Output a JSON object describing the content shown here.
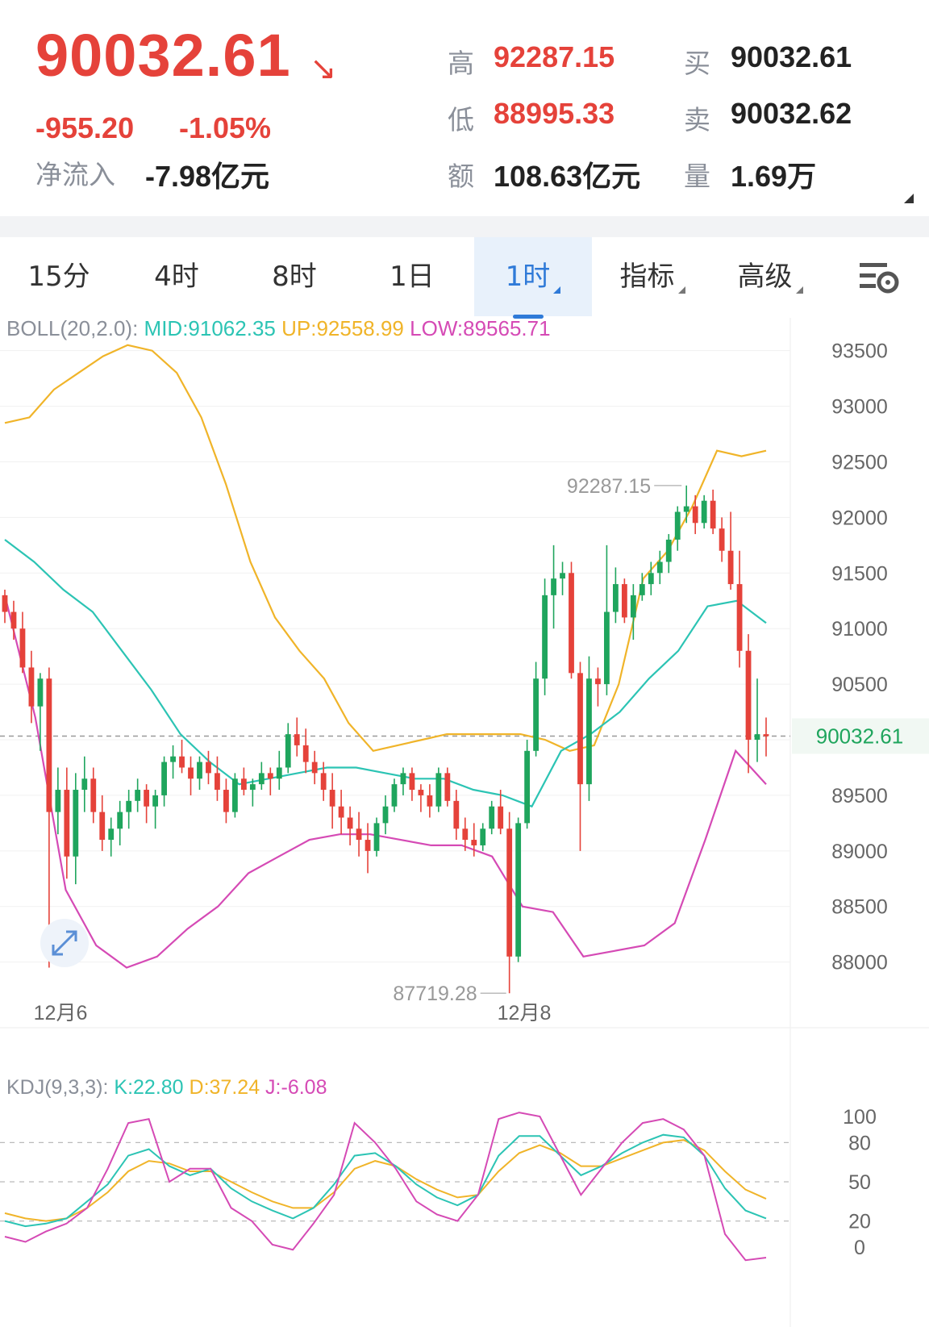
{
  "quote": {
    "price": "90032.61",
    "change": "-955.20",
    "change_pct": "-1.05%",
    "net_inflow_label": "净流入",
    "net_inflow_value": "-7.98亿元",
    "high_label": "高",
    "high_value": "92287.15",
    "low_label": "低",
    "low_value": "88995.33",
    "amount_label": "额",
    "amount_value": "108.63亿元",
    "buy_label": "买",
    "buy_value": "90032.61",
    "sell_label": "卖",
    "sell_value": "90032.62",
    "volume_label": "量",
    "volume_value": "1.69万"
  },
  "tabs": [
    {
      "label": "15分",
      "dropdown": false
    },
    {
      "label": "4时",
      "dropdown": false
    },
    {
      "label": "8时",
      "dropdown": false
    },
    {
      "label": "1日",
      "dropdown": false
    },
    {
      "label": "1时",
      "dropdown": true,
      "active": true
    },
    {
      "label": "指标",
      "dropdown": true
    },
    {
      "label": "高级",
      "dropdown": true
    }
  ],
  "boll": {
    "label": "BOLL(20,2.0):",
    "mid": "MID:91062.35",
    "up": "UP:92558.99",
    "low": "LOW:89565.71"
  },
  "kdj": {
    "label": "KDJ(9,3,3):",
    "k": "K:22.80",
    "d": "D:37.24",
    "j": "J:-6.08"
  },
  "colors": {
    "up": "#1fa55d",
    "down": "#e5423a",
    "mid": "#2cc4b4",
    "upper": "#f0b429",
    "lower": "#d54ab5",
    "accent": "#2f7ad8"
  },
  "chart_data": [
    {
      "type": "candlestick",
      "y_ticks": [
        "93500",
        "93000",
        "92500",
        "92000",
        "91500",
        "91000",
        "90500",
        "90000",
        "89500",
        "89000",
        "88500",
        "88000"
      ],
      "ylim": [
        87700,
        93650
      ],
      "x_labels": [
        "12月6",
        "12月8"
      ],
      "last_price": "90032.61",
      "annotations": {
        "high": "92287.15",
        "low": "87719.28"
      },
      "candles": [
        [
          91300,
          91350,
          91050,
          91150
        ],
        [
          91150,
          91250,
          90900,
          91000
        ],
        [
          91000,
          91150,
          90600,
          90650
        ],
        [
          90650,
          90800,
          90150,
          90300
        ],
        [
          90300,
          90600,
          89900,
          90550
        ],
        [
          90550,
          90650,
          87950,
          89350
        ],
        [
          89350,
          89750,
          89150,
          89550
        ],
        [
          89550,
          89750,
          88750,
          88950
        ],
        [
          88950,
          89700,
          88700,
          89550
        ],
        [
          89550,
          89850,
          89350,
          89650
        ],
        [
          89650,
          89750,
          89250,
          89350
        ],
        [
          89350,
          89500,
          89000,
          89100
        ],
        [
          89100,
          89300,
          88950,
          89200
        ],
        [
          89200,
          89450,
          89050,
          89350
        ],
        [
          89350,
          89550,
          89200,
          89450
        ],
        [
          89450,
          89650,
          89350,
          89550
        ],
        [
          89550,
          89600,
          89250,
          89400
        ],
        [
          89400,
          89550,
          89200,
          89500
        ],
        [
          89500,
          89850,
          89400,
          89800
        ],
        [
          89800,
          89950,
          89650,
          89850
        ],
        [
          89850,
          90000,
          89700,
          89750
        ],
        [
          89750,
          89850,
          89500,
          89650
        ],
        [
          89650,
          89850,
          89550,
          89800
        ],
        [
          89800,
          89900,
          89600,
          89700
        ],
        [
          89700,
          89850,
          89450,
          89550
        ],
        [
          89550,
          89650,
          89250,
          89350
        ],
        [
          89350,
          89700,
          89300,
          89650
        ],
        [
          89650,
          89750,
          89500,
          89550
        ],
        [
          89550,
          89650,
          89400,
          89600
        ],
        [
          89600,
          89800,
          89550,
          89700
        ],
        [
          89700,
          89750,
          89500,
          89650
        ],
        [
          89650,
          89900,
          89550,
          89750
        ],
        [
          89750,
          90150,
          89700,
          90050
        ],
        [
          90050,
          90200,
          89850,
          89950
        ],
        [
          89950,
          90100,
          89700,
          89800
        ],
        [
          89800,
          89900,
          89600,
          89700
        ],
        [
          89700,
          89800,
          89450,
          89550
        ],
        [
          89550,
          89700,
          89200,
          89400
        ],
        [
          89400,
          89550,
          89150,
          89300
        ],
        [
          89300,
          89400,
          89050,
          89200
        ],
        [
          89200,
          89350,
          88950,
          89100
        ],
        [
          89100,
          89250,
          88800,
          89000
        ],
        [
          89000,
          89300,
          88950,
          89250
        ],
        [
          89250,
          89500,
          89150,
          89400
        ],
        [
          89400,
          89650,
          89350,
          89600
        ],
        [
          89600,
          89750,
          89500,
          89700
        ],
        [
          89700,
          89750,
          89450,
          89550
        ],
        [
          89550,
          89600,
          89350,
          89500
        ],
        [
          89500,
          89600,
          89300,
          89400
        ],
        [
          89400,
          89750,
          89350,
          89700
        ],
        [
          89700,
          89750,
          89400,
          89450
        ],
        [
          89450,
          89550,
          89100,
          89200
        ],
        [
          89200,
          89300,
          89000,
          89100
        ],
        [
          89100,
          89250,
          88950,
          89050
        ],
        [
          89050,
          89250,
          89000,
          89200
        ],
        [
          89200,
          89450,
          89150,
          89400
        ],
        [
          89400,
          89550,
          89150,
          89200
        ],
        [
          89200,
          89350,
          87720,
          88050
        ],
        [
          88050,
          89300,
          88000,
          89250
        ],
        [
          89250,
          90000,
          89200,
          89900
        ],
        [
          89900,
          90700,
          89850,
          90550
        ],
        [
          90550,
          91450,
          90400,
          91300
        ],
        [
          91300,
          91750,
          91000,
          91450
        ],
        [
          91450,
          91600,
          91300,
          91500
        ],
        [
          91500,
          91600,
          90550,
          90600
        ],
        [
          90600,
          90700,
          89000,
          89600
        ],
        [
          89600,
          90750,
          89450,
          90550
        ],
        [
          90550,
          90650,
          90300,
          90500
        ],
        [
          90500,
          91750,
          90400,
          91150
        ],
        [
          91150,
          91550,
          91050,
          91400
        ],
        [
          91400,
          91450,
          91050,
          91100
        ],
        [
          91100,
          91400,
          90900,
          91300
        ],
        [
          91300,
          91500,
          91250,
          91400
        ],
        [
          91400,
          91600,
          91300,
          91500
        ],
        [
          91500,
          91700,
          91400,
          91600
        ],
        [
          91600,
          91850,
          91500,
          91800
        ],
        [
          91800,
          92100,
          91700,
          92050
        ],
        [
          92050,
          92287,
          91950,
          92100
        ],
        [
          92100,
          92200,
          91850,
          91950
        ],
        [
          91950,
          92200,
          91900,
          92150
        ],
        [
          92150,
          92250,
          91850,
          91900
        ],
        [
          91900,
          92000,
          91600,
          91700
        ],
        [
          91700,
          92050,
          91350,
          91400
        ],
        [
          91400,
          91700,
          90650,
          90800
        ],
        [
          90800,
          90950,
          89700,
          90000
        ],
        [
          90000,
          90550,
          89800,
          90050
        ],
        [
          90050,
          90200,
          89850,
          90032
        ]
      ],
      "boll_upper": [
        92850,
        92900,
        93150,
        93300,
        93450,
        93550,
        93500,
        93300,
        92900,
        92300,
        91600,
        91100,
        90800,
        90550,
        90150,
        89900,
        89950,
        90000,
        90050,
        90050,
        90050,
        90050,
        90000,
        89900,
        89950,
        90500,
        91450,
        91700,
        92100,
        92600,
        92550,
        92600
      ],
      "boll_mid": [
        91800,
        91600,
        91350,
        91150,
        90800,
        90450,
        90050,
        89800,
        89600,
        89650,
        89700,
        89750,
        89750,
        89700,
        89650,
        89650,
        89550,
        89500,
        89400,
        89900,
        90050,
        90250,
        90550,
        90800,
        91200,
        91250,
        91050
      ],
      "boll_lower": [
        91300,
        90200,
        88650,
        88150,
        87950,
        88050,
        88300,
        88500,
        88800,
        88950,
        89100,
        89150,
        89150,
        89100,
        89050,
        89050,
        88950,
        88500,
        88450,
        88050,
        88100,
        88150,
        88350,
        89100,
        89900,
        89600
      ],
      "kdj_ticks": [
        "100",
        "80",
        "50",
        "20",
        "0"
      ]
    }
  ]
}
